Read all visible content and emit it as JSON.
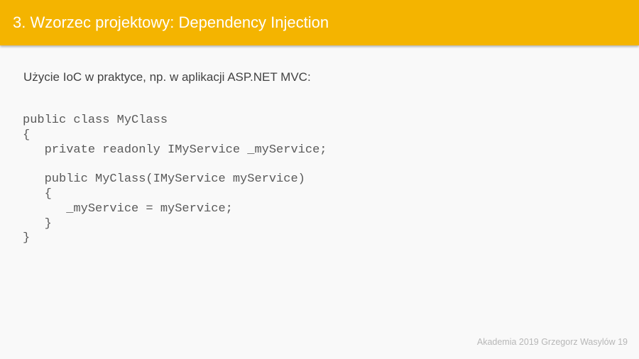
{
  "header": {
    "title": "3. Wzorzec projektowy: Dependency Injection",
    "color": "#f4b400"
  },
  "subtitle": "Użycie IoC w praktyce, np. w aplikacji ASP.NET MVC:",
  "code": {
    "lines": [
      "public class MyClass",
      "{",
      "   private readonly IMyService _myService;",
      "",
      "   public MyClass(IMyService myService)",
      "   {",
      "      _myService = myService;",
      "   }",
      "}"
    ]
  },
  "footer": {
    "text": "Akademia 2019 Grzegorz Wasylów 19"
  }
}
